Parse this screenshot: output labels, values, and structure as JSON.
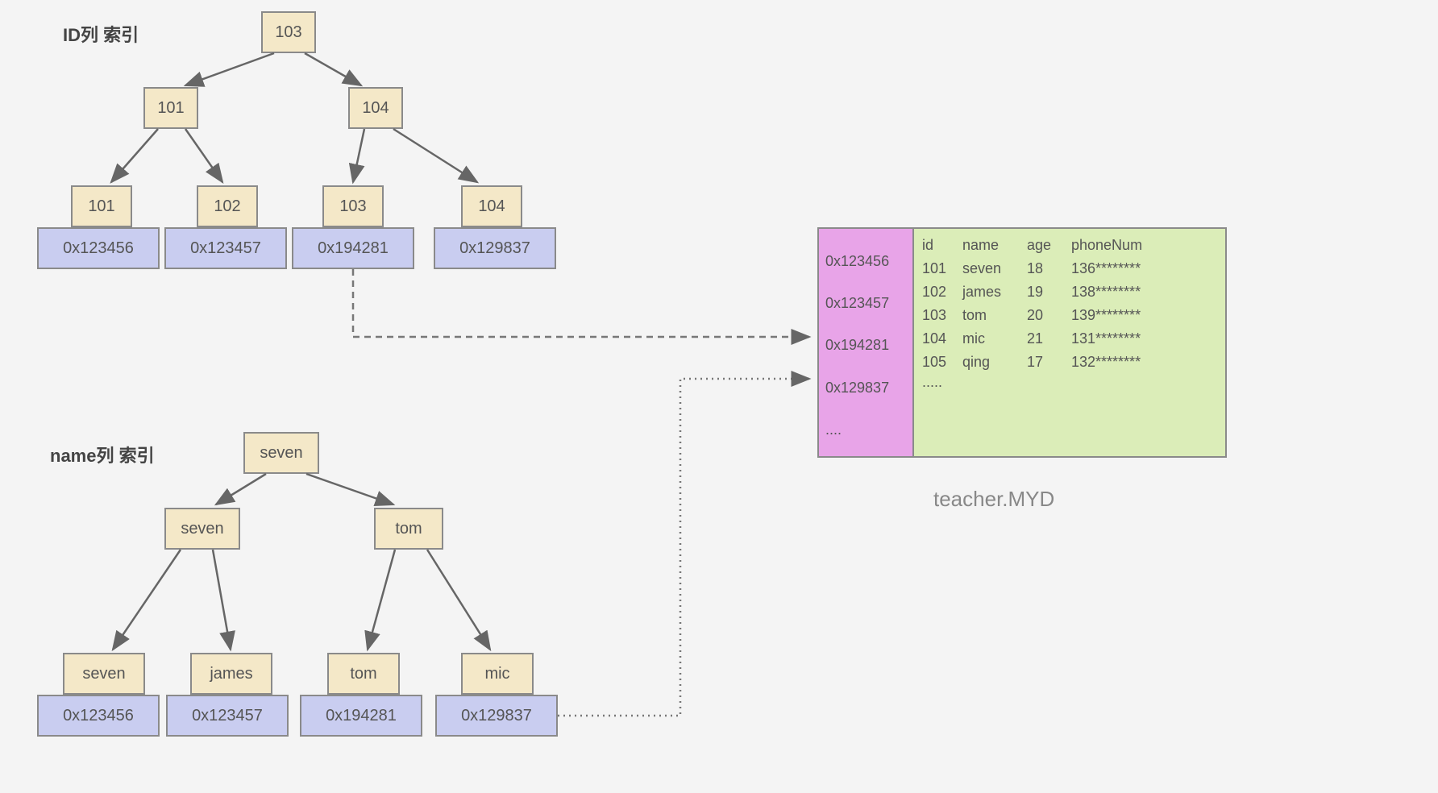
{
  "titles": {
    "id_index": "ID列 索引",
    "name_index": "name列 索引"
  },
  "id_tree": {
    "root": "103",
    "l1_left": "101",
    "l1_right": "104",
    "leaf1": {
      "key": "101",
      "addr": "0x123456"
    },
    "leaf2": {
      "key": "102",
      "addr": "0x123457"
    },
    "leaf3": {
      "key": "103",
      "addr": "0x194281"
    },
    "leaf4": {
      "key": "104",
      "addr": "0x129837"
    }
  },
  "name_tree": {
    "root": "seven",
    "l1_left": "seven",
    "l1_right": "tom",
    "leaf1": {
      "key": "seven",
      "addr": "0x123456"
    },
    "leaf2": {
      "key": "james",
      "addr": "0x123457"
    },
    "leaf3": {
      "key": "tom",
      "addr": "0x194281"
    },
    "leaf4": {
      "key": "mic",
      "addr": "0x129837"
    }
  },
  "table": {
    "caption": "teacher.MYD",
    "addr_refs": [
      "0x123456",
      "0x123457",
      "0x194281",
      "0x129837",
      "...."
    ],
    "headers": [
      "id",
      "name",
      "age",
      "phoneNum"
    ],
    "rows": [
      [
        "101",
        "seven",
        "18",
        "136********"
      ],
      [
        "102",
        "james",
        "19",
        "138********"
      ],
      [
        "103",
        "tom",
        "20",
        "139********"
      ],
      [
        "104",
        "mic",
        "21",
        "131********"
      ],
      [
        "105",
        "qing",
        "17",
        "132********"
      ]
    ],
    "more": "....."
  }
}
